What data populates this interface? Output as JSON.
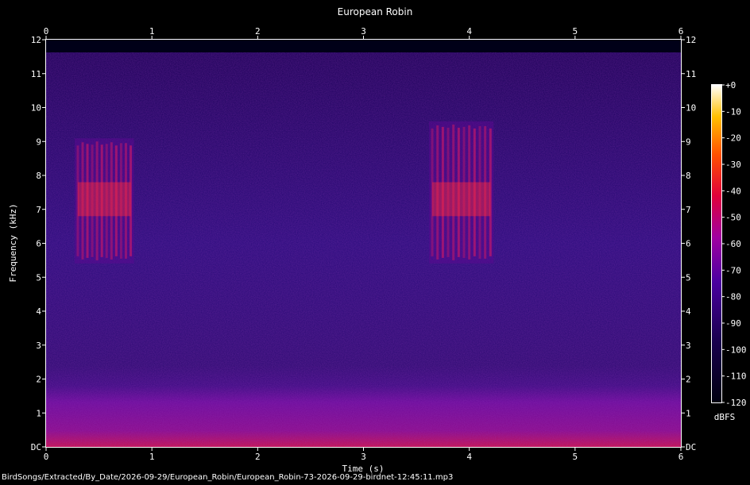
{
  "caption": "BirdSongs/Extracted/By_Date/2026-09-29/European_Robin/European_Robin-73-2026-09-29-birdnet-12:45:11.mp3",
  "chart_data": {
    "type": "heatmap",
    "title": "European Robin",
    "xlabel": "Time (s)",
    "ylabel": "Frequency (kHz)",
    "xlim": [
      0,
      6
    ],
    "ylim": [
      0,
      12
    ],
    "x_ticks": [
      "0",
      "1",
      "2",
      "3",
      "4",
      "5",
      "6"
    ],
    "y_ticks": [
      "DC",
      "1",
      "2",
      "3",
      "4",
      "5",
      "6",
      "7",
      "8",
      "9",
      "10",
      "11",
      "12"
    ],
    "colorbar": {
      "label": "dBFS",
      "ticks": [
        "+0",
        "-10",
        "-20",
        "-30",
        "-40",
        "-50",
        "-60",
        "-70",
        "-80",
        "-90",
        "-100",
        "-110",
        "-120"
      ],
      "range": [
        -120,
        0
      ]
    },
    "colors": {
      "background": "#000000",
      "low": "#000020",
      "mid": "#6a00a8",
      "high": "#ff3000",
      "max": "#ffffff"
    },
    "song_phrases": [
      {
        "start_s": 0.3,
        "end_s": 0.8,
        "freq_low_khz": 5.5,
        "freq_high_khz": 9.0
      },
      {
        "start_s": 3.65,
        "end_s": 4.2,
        "freq_low_khz": 5.5,
        "freq_high_khz": 9.5
      }
    ]
  }
}
